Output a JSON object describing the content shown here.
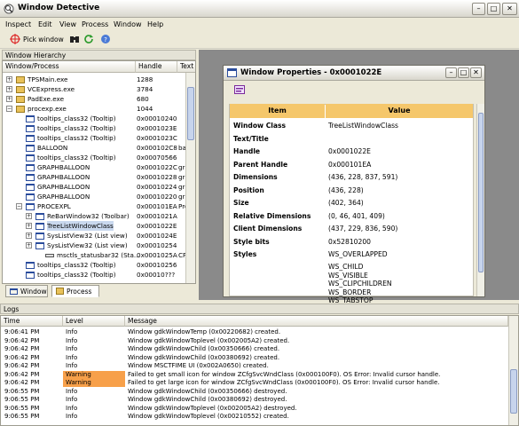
{
  "window": {
    "title": "Window Detective"
  },
  "menu": [
    "Inspect",
    "Edit",
    "View",
    "Process",
    "Window",
    "Help"
  ],
  "toolbar": {
    "pick_label": "Pick window"
  },
  "hierarchy": {
    "title": "Window Hierarchy",
    "columns": [
      "Window/Process",
      "Handle",
      "Text"
    ],
    "rows": [
      {
        "name": "TPSMain.exe",
        "handle": "1288",
        "text": ""
      },
      {
        "name": "VCExpress.exe",
        "handle": "3784",
        "text": ""
      },
      {
        "name": "PadExe.exe",
        "handle": "680",
        "text": ""
      },
      {
        "name": "procexp.exe",
        "handle": "1044",
        "text": ""
      },
      {
        "name": "tooltips_class32 (Tooltip)",
        "handle": "0x00010240",
        "text": ""
      },
      {
        "name": "tooltips_class32 (Tooltip)",
        "handle": "0x0001023E",
        "text": ""
      },
      {
        "name": "tooltips_class32 (Tooltip)",
        "handle": "0x0001023C",
        "text": ""
      },
      {
        "name": "BALLOON",
        "handle": "0x000102C8",
        "text": "balloon"
      },
      {
        "name": "tooltips_class32 (Tooltip)",
        "handle": "0x00070566",
        "text": ""
      },
      {
        "name": "GRAPHBALLOON",
        "handle": "0x0001022C",
        "text": "graph"
      },
      {
        "name": "GRAPHBALLOON",
        "handle": "0x00010228",
        "text": "graph"
      },
      {
        "name": "GRAPHBALLOON",
        "handle": "0x00010224",
        "text": "graph"
      },
      {
        "name": "GRAPHBALLOON",
        "handle": "0x00010220",
        "text": "graph"
      },
      {
        "name": "PROCEXPL",
        "handle": "0x000101EA",
        "text": "Proc"
      },
      {
        "name": "ReBarWindow32 (Toolbar)",
        "handle": "0x0001021A",
        "text": ""
      },
      {
        "name": "TreeListWindowClass",
        "handle": "0x0001022E",
        "text": ""
      },
      {
        "name": "SysListView32 (List view)",
        "handle": "0x0001024E",
        "text": ""
      },
      {
        "name": "SysListView32 (List view)",
        "handle": "0x00010254",
        "text": ""
      },
      {
        "name": "msctls_statusbar32 (Sta...",
        "handle": "0x0001025A",
        "text": "CPU"
      },
      {
        "name": "tooltips_class32 (Tooltip)",
        "handle": "0x00010256",
        "text": ""
      },
      {
        "name": "tooltips_class32 (Tooltip)",
        "handle": "0x00010???",
        "text": ""
      }
    ]
  },
  "tabs": [
    "Window",
    "Process"
  ],
  "properties": {
    "title": "Window Properties - 0x0001022E",
    "col_item": "Item",
    "col_value": "Value",
    "rows": [
      {
        "k": "Window Class",
        "v": "TreeListWindowClass"
      },
      {
        "k": "Text/Title",
        "v": ""
      },
      {
        "k": "Handle",
        "v": "0x0001022E"
      },
      {
        "k": "Parent Handle",
        "v": "0x000101EA"
      },
      {
        "k": "Dimensions",
        "v": "(436, 228, 837, 591)"
      },
      {
        "k": "Position",
        "v": "(436, 228)"
      },
      {
        "k": "Size",
        "v": "(402, 364)"
      },
      {
        "k": "Relative Dimensions",
        "v": "(0, 46, 401, 409)"
      },
      {
        "k": "Client Dimensions",
        "v": "(437, 229, 836, 590)"
      },
      {
        "k": "Style bits",
        "v": "0x52810200"
      },
      {
        "k": "Styles",
        "v": "WS_OVERLAPPED"
      }
    ],
    "styles_extra": [
      "WS_CHILD",
      "WS_VISIBLE",
      "WS_CLIPCHILDREN",
      "WS_BORDER",
      "WS_TABSTOP"
    ]
  },
  "logs": {
    "title": "Logs",
    "columns": [
      "Time",
      "Level",
      "Message"
    ],
    "rows": [
      {
        "t": "9:06:41 PM",
        "l": "Info",
        "m": "Window gdkWindowTemp (0x00220682) created."
      },
      {
        "t": "9:06:42 PM",
        "l": "Info",
        "m": "Window gdkWindowToplevel (0x002005A2) created."
      },
      {
        "t": "9:06:42 PM",
        "l": "Info",
        "m": "Window gdkWindowChild (0x00350666) created."
      },
      {
        "t": "9:06:42 PM",
        "l": "Info",
        "m": "Window gdkWindowChild (0x00380692) created."
      },
      {
        "t": "9:06:42 PM",
        "l": "Info",
        "m": "Window MSCTFIME UI (0x002A0650) created."
      },
      {
        "t": "9:06:42 PM",
        "l": "Warning",
        "m": "Failed to get small icon for window ZCfgSvcWndClass (0x000100F0). OS Error: Invalid cursor handle."
      },
      {
        "t": "9:06:42 PM",
        "l": "Warning",
        "m": "Failed to get large icon for window ZCfgSvcWndClass (0x000100F0). OS Error: Invalid cursor handle."
      },
      {
        "t": "9:06:55 PM",
        "l": "Info",
        "m": "Window gdkWindowChild (0x00350666) destroyed."
      },
      {
        "t": "9:06:55 PM",
        "l": "Info",
        "m": "Window gdkWindowChild (0x00380692) destroyed."
      },
      {
        "t": "9:06:55 PM",
        "l": "Info",
        "m": "Window gdkWindowToplevel (0x002005A2) destroyed."
      },
      {
        "t": "9:06:55 PM",
        "l": "Info",
        "m": "Window gdkWindowToplevel (0x00210552) created."
      }
    ]
  },
  "colors": {
    "warning": "#f7a04a",
    "prop_header": "#f5c76b",
    "selection": "#c9d8ee"
  }
}
